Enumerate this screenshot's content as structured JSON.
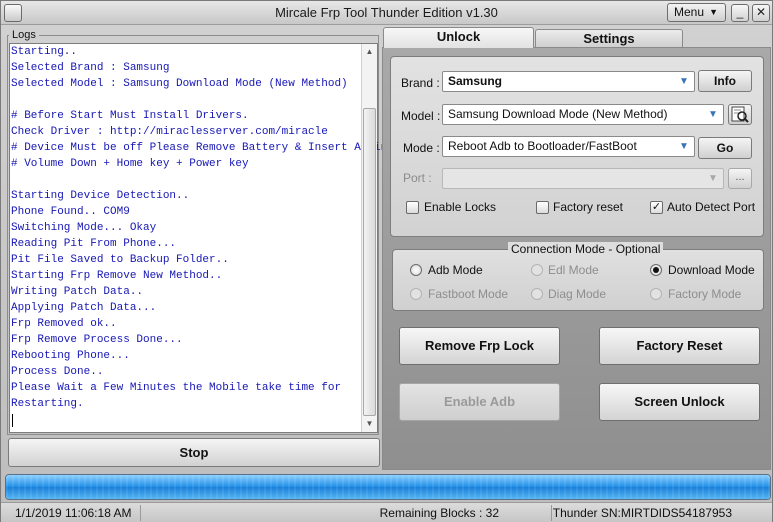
{
  "window": {
    "title": "Mircale Frp Tool Thunder Edition v1.30",
    "menu_label": "Menu",
    "minimize_glyph": "_",
    "close_glyph": "✕"
  },
  "logs": {
    "legend": "Logs",
    "lines": [
      " Starting..",
      " Selected Brand : Samsung",
      " Selected Model : Samsung Download Mode (New Method)",
      "",
      " # Before Start Must Install Drivers.",
      " Check Driver : http://miraclesserver.com/miracle",
      " # Device Must be off Please Remove Battery & Insert Again",
      " # Volume Down + Home key + Power key",
      "",
      "Starting Device Detection..",
      "Phone Found.. COM9",
      "Switching Mode... Okay",
      "Reading Pit From Phone...",
      "Pit File Saved to Backup Folder..",
      "Starting Frp Remove New Method..",
      "Writing Patch Data..",
      "Applying Patch Data...",
      "Frp Removed ok..",
      "Frp Remove Process Done...",
      "Rebooting Phone...",
      " Process Done..",
      " Please Wait a Few Minutes the Mobile take time for",
      "Restarting."
    ]
  },
  "stop_label": "Stop",
  "tabs": [
    {
      "label": "Unlock",
      "active": true
    },
    {
      "label": "Settings",
      "active": false
    }
  ],
  "form": {
    "brand_label": "Brand :",
    "brand_value": "Samsung",
    "info_button": "Info",
    "model_label": "Model :",
    "model_value": "Samsung Download Mode (New Method)",
    "mode_label": "Mode :",
    "mode_value": "Reboot Adb to Bootloader/FastBoot",
    "go_button": "Go",
    "port_label": "Port :",
    "port_value": "",
    "port_more": "...",
    "enable_locks": {
      "label": "Enable Locks",
      "checked": false
    },
    "factory_reset": {
      "label": "Factory reset",
      "checked": false
    },
    "auto_detect": {
      "label": "Auto Detect Port",
      "checked": true
    }
  },
  "connection": {
    "legend": "Connection Mode - Optional",
    "options": [
      {
        "label": "Adb Mode",
        "checked": false,
        "enabled": true
      },
      {
        "label": "Edl Mode",
        "checked": false,
        "enabled": false
      },
      {
        "label": "Download Mode",
        "checked": true,
        "enabled": true
      },
      {
        "label": "Fastboot Mode",
        "checked": false,
        "enabled": false
      },
      {
        "label": "Diag Mode",
        "checked": false,
        "enabled": false
      },
      {
        "label": "Factory Mode",
        "checked": false,
        "enabled": false
      }
    ]
  },
  "actions": {
    "remove_frp": "Remove Frp Lock",
    "factory_reset": "Factory Reset",
    "enable_adb": "Enable Adb",
    "screen_unlock": "Screen Unlock"
  },
  "progress": {
    "value": 1.0
  },
  "status": {
    "datetime": "1/1/2019 11:06:18 AM",
    "remaining": "Remaining Blocks : 32",
    "serial": "Thunder SN:MIRTDIDS54187953"
  },
  "colors": {
    "log_text": "#1717b5",
    "progress": "#1e8ee6"
  }
}
